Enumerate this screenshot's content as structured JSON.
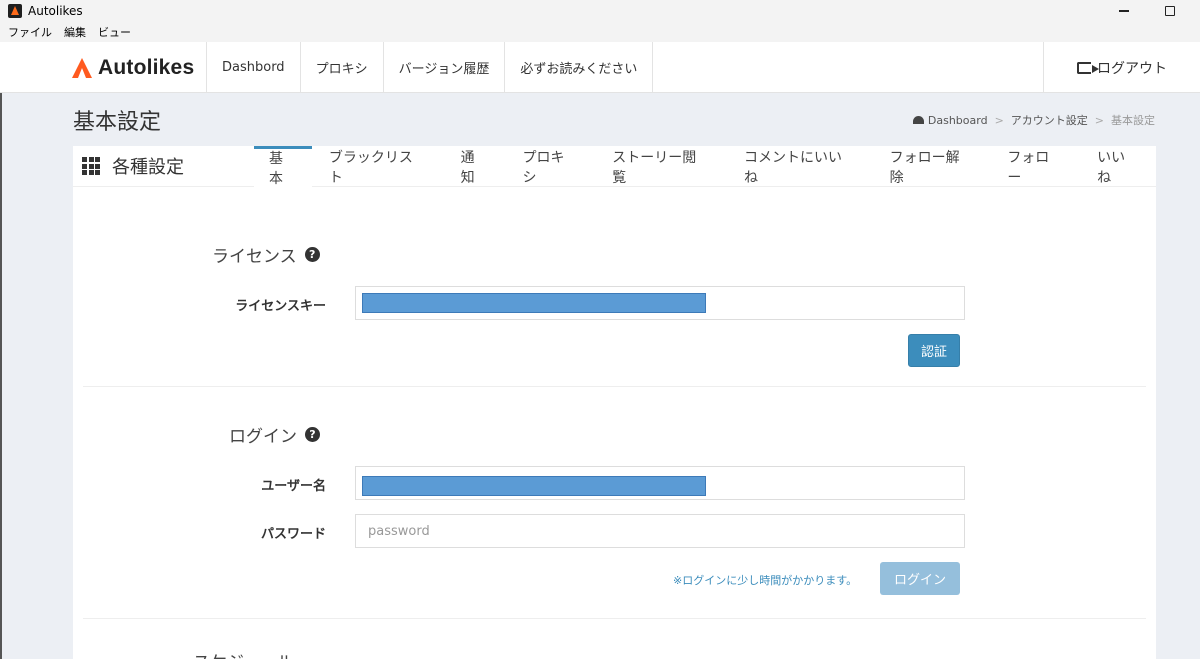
{
  "window": {
    "title": "Autolikes"
  },
  "menubar": {
    "items": [
      "ファイル",
      "編集",
      "ビュー"
    ]
  },
  "navbar": {
    "brand": "Autolikes",
    "items": [
      "Dashbord",
      "プロキシ",
      "バージョン履歴",
      "必ずお読みください"
    ],
    "logout": "ログアウト"
  },
  "page": {
    "title": "基本設定",
    "breadcrumb": [
      "Dashboard",
      "アカウント設定",
      "基本設定"
    ],
    "breadcrumb_sep": ">"
  },
  "panel": {
    "title": "各種設定",
    "tabs": [
      "基本",
      "ブラックリスト",
      "通知",
      "プロキシ",
      "ストーリー閲覧",
      "コメントにいいね",
      "フォロー解除",
      "フォロー",
      "いいね"
    ]
  },
  "license": {
    "title": "ライセンス",
    "key_label": "ライセンスキー",
    "verify_button": "認証"
  },
  "login": {
    "title": "ログイン",
    "username_label": "ユーザー名",
    "password_label": "パスワード",
    "password_placeholder": "password",
    "note": "※ログインに少し時間がかかります。",
    "login_button": "ログイン"
  },
  "next_section": {
    "title": "スケジュール"
  },
  "colors": {
    "accent": "#3c8dbc",
    "brand": "#ff5a1f",
    "redaction": "#5b9bd5"
  }
}
